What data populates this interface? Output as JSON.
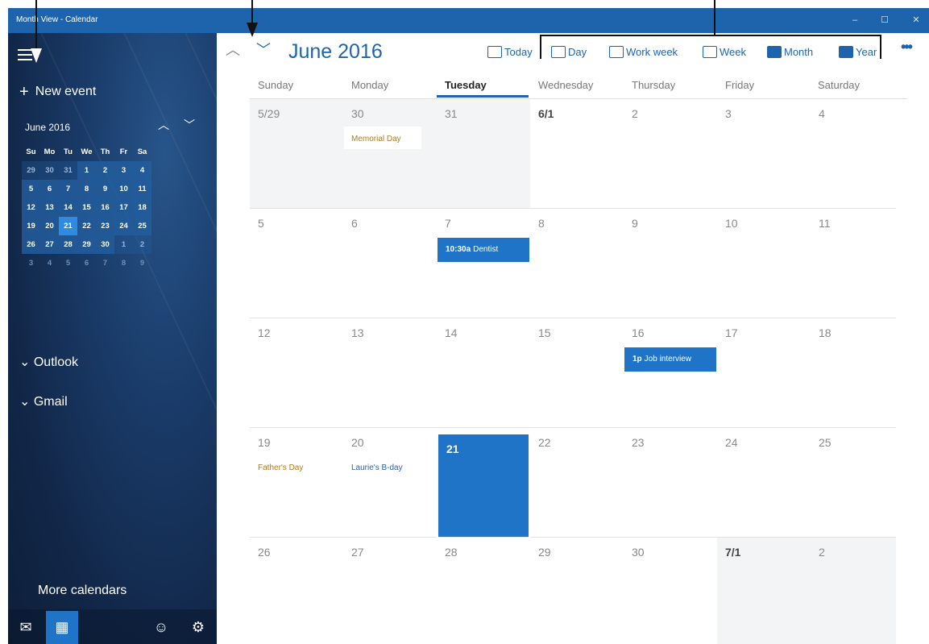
{
  "window": {
    "title": "Month View - Calendar",
    "minimize_glyph": "–",
    "maximize_glyph": "☐",
    "close_glyph": "✕"
  },
  "sidebar": {
    "new_event_label": "New event",
    "mini_calendar": {
      "title": "June 2016",
      "weekdays": [
        "Su",
        "Mo",
        "Tu",
        "We",
        "Th",
        "Fr",
        "Sa"
      ],
      "weeks": [
        [
          "29",
          "30",
          "31",
          "1",
          "2",
          "3",
          "4"
        ],
        [
          "5",
          "6",
          "7",
          "8",
          "9",
          "10",
          "11"
        ],
        [
          "12",
          "13",
          "14",
          "15",
          "16",
          "17",
          "18"
        ],
        [
          "19",
          "20",
          "21",
          "22",
          "23",
          "24",
          "25"
        ],
        [
          "26",
          "27",
          "28",
          "29",
          "30",
          "1",
          "2"
        ],
        [
          "3",
          "4",
          "5",
          "6",
          "7",
          "8",
          "9"
        ]
      ],
      "selected_day": "21"
    },
    "accounts": [
      "Outlook",
      "Gmail"
    ],
    "more_calendars_label": "More calendars",
    "bottom_icons": [
      "mail-icon",
      "calendar-icon",
      "smiley-icon",
      "settings-icon"
    ]
  },
  "header": {
    "month_title": "June 2016",
    "views": [
      {
        "label": "Today",
        "icon": "today-icon"
      },
      {
        "label": "Day",
        "icon": "day-icon"
      },
      {
        "label": "Work week",
        "icon": "work-week-icon"
      },
      {
        "label": "Week",
        "icon": "week-icon"
      },
      {
        "label": "Month",
        "icon": "month-icon"
      },
      {
        "label": "Year",
        "icon": "year-icon"
      }
    ],
    "more_label": "•••"
  },
  "calendar": {
    "day_names": [
      "Sunday",
      "Monday",
      "Tuesday",
      "Wednesday",
      "Thursday",
      "Friday",
      "Saturday"
    ],
    "today_column": "Tuesday",
    "weeks": [
      [
        {
          "label": "5/29",
          "state": "past"
        },
        {
          "label": "30",
          "state": "past",
          "holiday": "Memorial Day",
          "holiday_color": "#b07a1a"
        },
        {
          "label": "31",
          "state": "past"
        },
        {
          "label": "6/1",
          "bold": true
        },
        {
          "label": "2"
        },
        {
          "label": "3"
        },
        {
          "label": "4"
        }
      ],
      [
        {
          "label": "5"
        },
        {
          "label": "6"
        },
        {
          "label": "7",
          "event": {
            "time": "10:30a",
            "title": "Dentist"
          }
        },
        {
          "label": "8"
        },
        {
          "label": "9"
        },
        {
          "label": "10"
        },
        {
          "label": "11"
        }
      ],
      [
        {
          "label": "12"
        },
        {
          "label": "13"
        },
        {
          "label": "14"
        },
        {
          "label": "15"
        },
        {
          "label": "16",
          "event": {
            "time": "1p",
            "title": "Job interview"
          }
        },
        {
          "label": "17"
        },
        {
          "label": "18"
        }
      ],
      [
        {
          "label": "19",
          "holiday": "Father's Day",
          "holiday_color": "#b07a1a"
        },
        {
          "label": "20",
          "holiday": "Laurie's B-day",
          "holiday_color": "#2a62a8"
        },
        {
          "label": "21",
          "state": "today"
        },
        {
          "label": "22"
        },
        {
          "label": "23"
        },
        {
          "label": "24"
        },
        {
          "label": "25"
        }
      ],
      [
        {
          "label": "26"
        },
        {
          "label": "27"
        },
        {
          "label": "28"
        },
        {
          "label": "29"
        },
        {
          "label": "30"
        },
        {
          "label": "7/1",
          "bold": true,
          "state": "next"
        },
        {
          "label": "2",
          "state": "next"
        }
      ]
    ]
  },
  "colors": {
    "accent": "#1e64ad",
    "today_fill": "#1f74c8",
    "past_fill": "#f3f4f5"
  }
}
